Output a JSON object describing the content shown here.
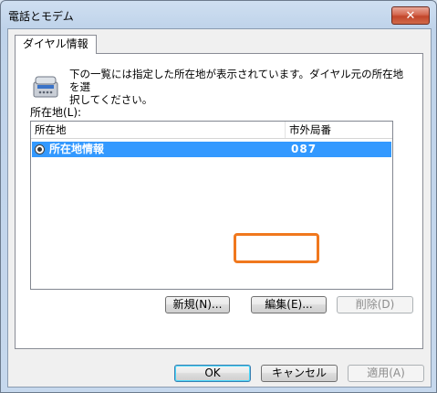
{
  "window": {
    "title": "電話とモデム",
    "close_symbol": "✕"
  },
  "tabs": [
    {
      "label": "ダイヤル情報"
    }
  ],
  "panel": {
    "description_line1": "下の一覧には指定した所在地が表示されています。ダイヤル元の所在地を選",
    "description_line2": "択してください。",
    "locations_label": "所在地(L):"
  },
  "listview": {
    "columns": [
      "所在地",
      "市外局番"
    ],
    "rows": [
      {
        "location": "所在地情報",
        "area_code": "087",
        "selected": true
      }
    ]
  },
  "panel_buttons": {
    "new": "新規(N)...",
    "edit": "編集(E)...",
    "delete": "削除(D)"
  },
  "dialog_buttons": {
    "ok": "OK",
    "cancel": "キャンセル",
    "apply": "適用(A)"
  },
  "colors": {
    "selection": "#3399ff",
    "highlight_frame": "#f0781e"
  },
  "icons": {
    "dialing": "telephone-icon",
    "row": "radio-selected-icon"
  }
}
